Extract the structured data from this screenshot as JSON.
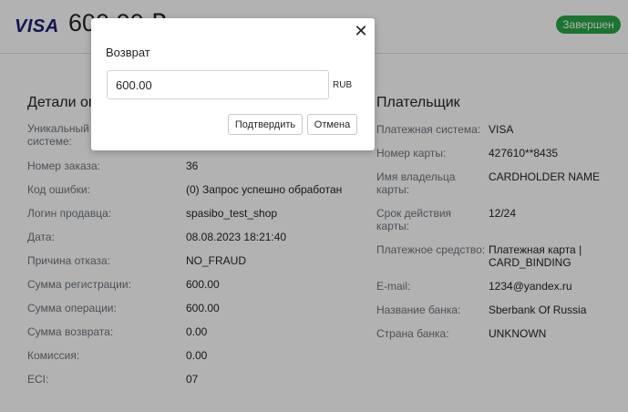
{
  "header": {
    "brand_logo": "VISA",
    "amount": "600.00 ₽",
    "status": "Завершен",
    "status_color": "#28a745"
  },
  "details": {
    "title": "Детали оп",
    "rows": [
      {
        "label": "Уникальный номер в\nсистеме:",
        "value": ""
      },
      {
        "label": "Номер заказа:",
        "value": "36"
      },
      {
        "label": "Код ошибки:",
        "value": "(0) Запрос успешно обработан"
      },
      {
        "label": "Логин продавца:",
        "value": "spasibo_test_shop"
      },
      {
        "label": "Дата:",
        "value": "08.08.2023 18:21:40"
      },
      {
        "label": "Причина отказа:",
        "value": "NO_FRAUD"
      },
      {
        "label": "Сумма регистрации:",
        "value": "600.00"
      },
      {
        "label": "Сумма операции:",
        "value": "600.00"
      },
      {
        "label": "Сумма возврата:",
        "value": "0.00"
      },
      {
        "label": "Комиссия:",
        "value": "0.00"
      },
      {
        "label": "ECI:",
        "value": "07"
      }
    ]
  },
  "payer": {
    "title": "Плательщик",
    "rows": [
      {
        "label": "Платежная система:",
        "value": "VISA"
      },
      {
        "label": "Номер карты:",
        "value": "427610**8435"
      },
      {
        "label": "Имя владельца\nкарты:",
        "value": "CARDHOLDER NAME"
      },
      {
        "label": "Срок действия\nкарты:",
        "value": "12/24"
      },
      {
        "label": "Платежное средство:",
        "value": "Платежная карта |\nCARD_BINDING"
      },
      {
        "label": "E-mail:",
        "value": "1234@yandex.ru"
      },
      {
        "label": "Название банка:",
        "value": "Sberbank Of Russia"
      },
      {
        "label": "Страна банка:",
        "value": "UNKNOWN"
      }
    ]
  },
  "modal": {
    "title": "Возврат",
    "amount_value": "600.00",
    "currency": "RUB",
    "confirm_label": "Подтвердить",
    "cancel_label": "Отмена",
    "close_icon": "close-icon"
  }
}
